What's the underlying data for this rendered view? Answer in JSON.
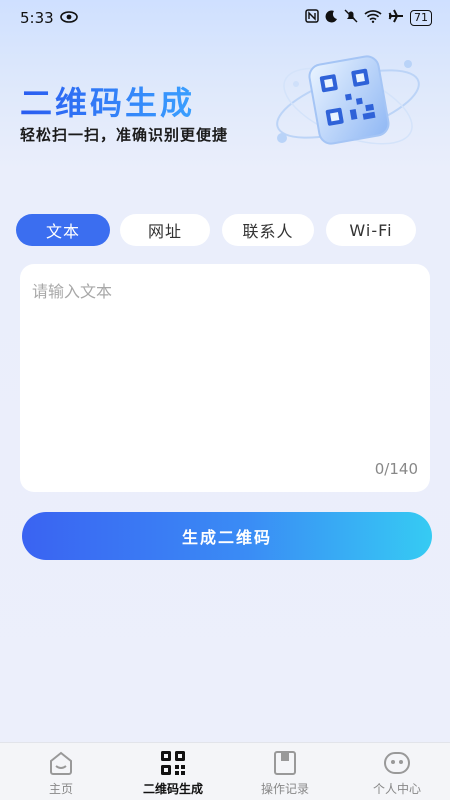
{
  "status_bar": {
    "time": "5:33",
    "eye_icon": "eye-icon",
    "right_icons": [
      "nfc-icon",
      "moon-icon",
      "mute-icon",
      "wifi-icon",
      "airplane-icon"
    ],
    "battery": "71"
  },
  "hero": {
    "title": "二维码生成",
    "subtitle": "轻松扫一扫，准确识别更便捷",
    "art_icon": "qr-code-illustration"
  },
  "tabs": [
    {
      "label": "文本",
      "active": true
    },
    {
      "label": "网址",
      "active": false
    },
    {
      "label": "联系人",
      "active": false
    },
    {
      "label": "Wi-Fi",
      "active": false
    }
  ],
  "input": {
    "placeholder": "请输入文本",
    "value": "",
    "counter": "0/140"
  },
  "generate_button": {
    "label": "生成二维码"
  },
  "bottom_nav": [
    {
      "label": "主页",
      "icon": "home-icon",
      "active": false
    },
    {
      "label": "二维码生成",
      "icon": "qr-code-icon",
      "active": true
    },
    {
      "label": "操作记录",
      "icon": "record-icon",
      "active": false
    },
    {
      "label": "个人中心",
      "icon": "profile-icon",
      "active": false
    }
  ],
  "colors": {
    "accent": "#3b6ef0",
    "button_gradient_start": "#3a63f2",
    "button_gradient_end": "#36cbf3"
  }
}
